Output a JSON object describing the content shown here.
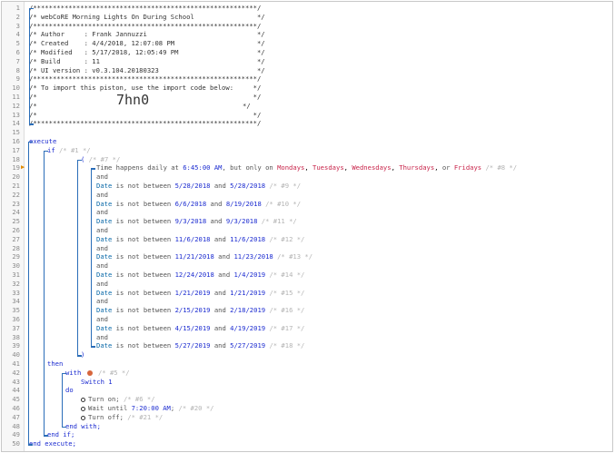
{
  "header": {
    "stars": "/*********************************************************/",
    "title": "/* webCoRE Morning Lights On During School                */",
    "author": "/* Author     : Frank Jannuzzi                            */",
    "created": "/* Created    : 4/4/2018, 12:07:08 PM                     */",
    "modified": "/* Modified   : 5/17/2018, 12:05:49 PM                    */",
    "build": "/* Build      : 11                                        */",
    "ui_version": "/* UI version : v0.3.104.20180323                         */",
    "import_hint": "/* To import this piston, use the import code below:     */",
    "blank": "/*                                                       */",
    "import_left": "/*",
    "import_code": "7hn0",
    "import_right": "*/"
  },
  "kw": {
    "execute": "execute",
    "if": "if",
    "then": "then",
    "with": "with",
    "do": "do",
    "and": "and",
    "end_with": "end with;",
    "end_if": "end if;",
    "end_execute": "end execute;",
    "open_paren": "(",
    "close_paren": ")",
    "date": "Date",
    "is_not_between": "is not between",
    "and_word": "and"
  },
  "cmt": {
    "if": "/* #1 */",
    "group": "/* #7 */",
    "time": "/* #8 */",
    "with": "/* #5 */",
    "turn_on": "/* #6 */",
    "wait": "/* #20 */",
    "turn_off": "/* #21 */"
  },
  "time_cond": {
    "prefix": "Time happens daily at",
    "time": "6:45:00 AM",
    "mid": ", but only on",
    "days": [
      "Mondays",
      "Tuesdays",
      "Wednesdays",
      "Thursdays",
      "Fridays"
    ],
    "or": "or"
  },
  "date_conditions": [
    {
      "from": "5/28/2018",
      "to": "5/28/2018",
      "comment": "/* #9 */"
    },
    {
      "from": "6/6/2018",
      "to": "8/19/2018",
      "comment": "/* #10 */"
    },
    {
      "from": "9/3/2018",
      "to": "9/3/2018",
      "comment": "/* #11 */"
    },
    {
      "from": "11/6/2018",
      "to": "11/6/2018",
      "comment": "/* #12 */"
    },
    {
      "from": "11/21/2018",
      "to": "11/23/2018",
      "comment": "/* #13 */"
    },
    {
      "from": "12/24/2018",
      "to": "1/4/2019",
      "comment": "/* #14 */"
    },
    {
      "from": "1/21/2019",
      "to": "1/21/2019",
      "comment": "/* #15 */"
    },
    {
      "from": "2/15/2019",
      "to": "2/18/2019",
      "comment": "/* #16 */"
    },
    {
      "from": "4/15/2019",
      "to": "4/19/2019",
      "comment": "/* #17 */"
    },
    {
      "from": "5/27/2019",
      "to": "5/27/2019",
      "comment": "/* #18 */"
    }
  ],
  "device": "Switch 1",
  "actions": {
    "turn_on": "Turn on;",
    "wait_prefix": "Wait until",
    "wait_time": "7:20:00 AM",
    "wait_suffix": ";",
    "turn_off": "Turn off;"
  },
  "line_count": 50
}
